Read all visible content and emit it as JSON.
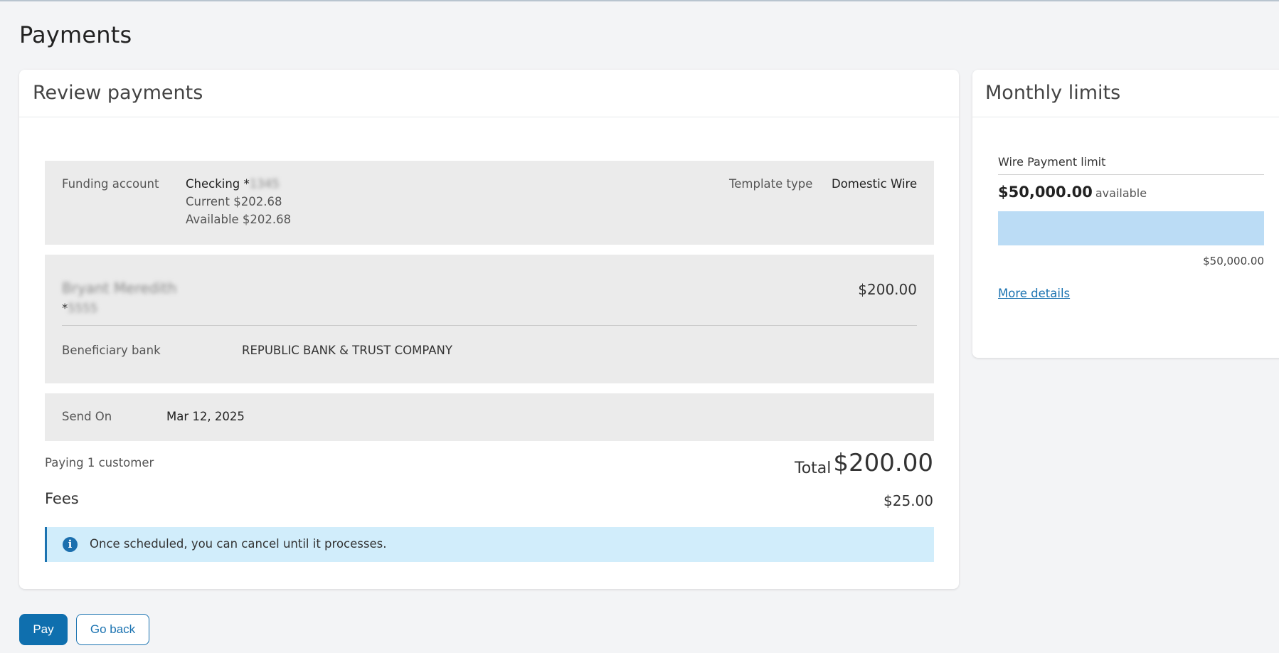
{
  "page": {
    "title": "Payments"
  },
  "review": {
    "header": "Review payments",
    "funding": {
      "label": "Funding account",
      "account_name": "Checking *",
      "account_masked": "1345",
      "current": "Current $202.68",
      "available": "Available $202.68",
      "template_type_label": "Template type",
      "template_type_value": "Domestic Wire"
    },
    "beneficiary": {
      "name": "Bryant Meredith",
      "account_prefix": "*",
      "account_masked": "5555",
      "amount": "$200.00",
      "bank_label": "Beneficiary bank",
      "bank_value": "REPUBLIC BANK & TRUST COMPANY"
    },
    "send": {
      "label": "Send On",
      "value": "Mar 12, 2025"
    },
    "summary": {
      "paying": "Paying 1 customer",
      "total_label": "Total",
      "total_value": "$200.00",
      "fees_label": "Fees",
      "fees_value": "$25.00"
    },
    "info": {
      "icon": "info-icon",
      "text": "Once scheduled, you can cancel until it processes."
    }
  },
  "actions": {
    "pay_label": "Pay",
    "back_label": "Go back"
  },
  "limits": {
    "header": "Monthly limits",
    "wire_label": "Wire Payment limit",
    "amount": "$50,000.00",
    "available_word": "available",
    "fill_fraction": 1.0,
    "max": "$50,000.00",
    "more_details": "More details"
  },
  "colors": {
    "primary": "#0f6fae",
    "info_bg": "#d1edfb",
    "bar_fill": "#bbdcf5",
    "panel_bg": "#ebebeb"
  }
}
